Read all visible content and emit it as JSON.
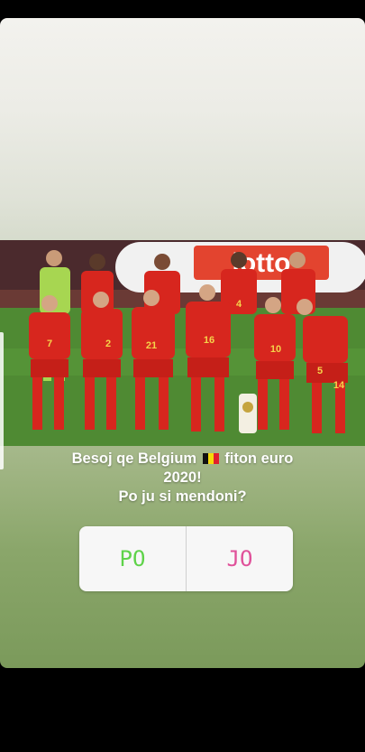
{
  "story": {
    "caption_line1_before_flag": "Besoj qe Belgium",
    "caption_line1_after_flag": "fiton euro",
    "caption_line2": "2020!",
    "caption_line3": "Po ju si mendoni?",
    "flag_icon": "belgium-flag-icon"
  },
  "photo": {
    "banner_text": "lotto",
    "jersey_numbers": [
      "7",
      "2",
      "21",
      "16",
      "10",
      "14",
      "4",
      "5"
    ]
  },
  "poll": {
    "option_yes": "PO",
    "option_no": "JO"
  },
  "colors": {
    "yes": "#5fd34a",
    "no": "#e0519a",
    "jersey": "#d7261e"
  }
}
